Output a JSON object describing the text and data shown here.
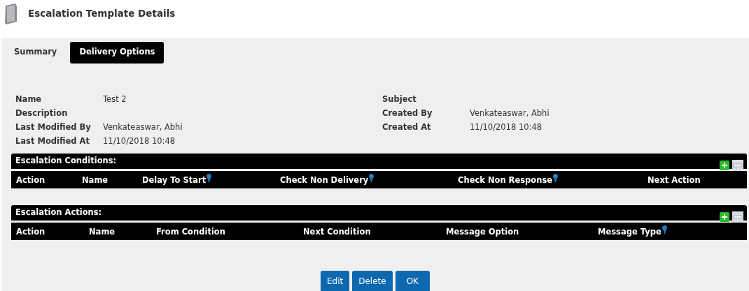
{
  "page": {
    "title": "Escalation Template Details"
  },
  "tabs": [
    {
      "label": "Summary",
      "selected": false
    },
    {
      "label": "Delivery Options",
      "selected": true
    }
  ],
  "fields_left": [
    {
      "label": "Name",
      "value": "Test 2"
    },
    {
      "label": "Description"
    },
    {
      "label": "Last Modified By",
      "value": "Venkateaswar, Abhi"
    },
    {
      "label": "Last Modified At",
      "value": "11/10/2018 10:48"
    }
  ],
  "fields_right": [
    {
      "label": "Subject"
    },
    {
      "label": "Created By",
      "value": "Venkateaswar, Abhi"
    },
    {
      "label": "Created At",
      "value": "11/10/2018 10:48"
    }
  ],
  "tables": [
    {
      "title": "Escalation Conditions:",
      "columns": [
        {
          "label": "Action",
          "info": false
        },
        {
          "label": "Name",
          "info": false
        },
        {
          "label": "Delay To Start",
          "info": true
        },
        {
          "label": "Check Non Delivery",
          "info": true
        },
        {
          "label": "Check Non Response",
          "info": true
        },
        {
          "label": "Next Action",
          "info": false
        }
      ]
    },
    {
      "title": "Escalation Actions:",
      "columns": [
        {
          "label": "Action",
          "info": false
        },
        {
          "label": "Name",
          "info": false
        },
        {
          "label": "From Condition",
          "info": false
        },
        {
          "label": "Next Condition",
          "info": false
        },
        {
          "label": "Message Option",
          "info": false
        },
        {
          "label": "Message Type",
          "info": true
        }
      ]
    }
  ],
  "buttons": [
    "Edit",
    "Delete",
    "OK"
  ]
}
